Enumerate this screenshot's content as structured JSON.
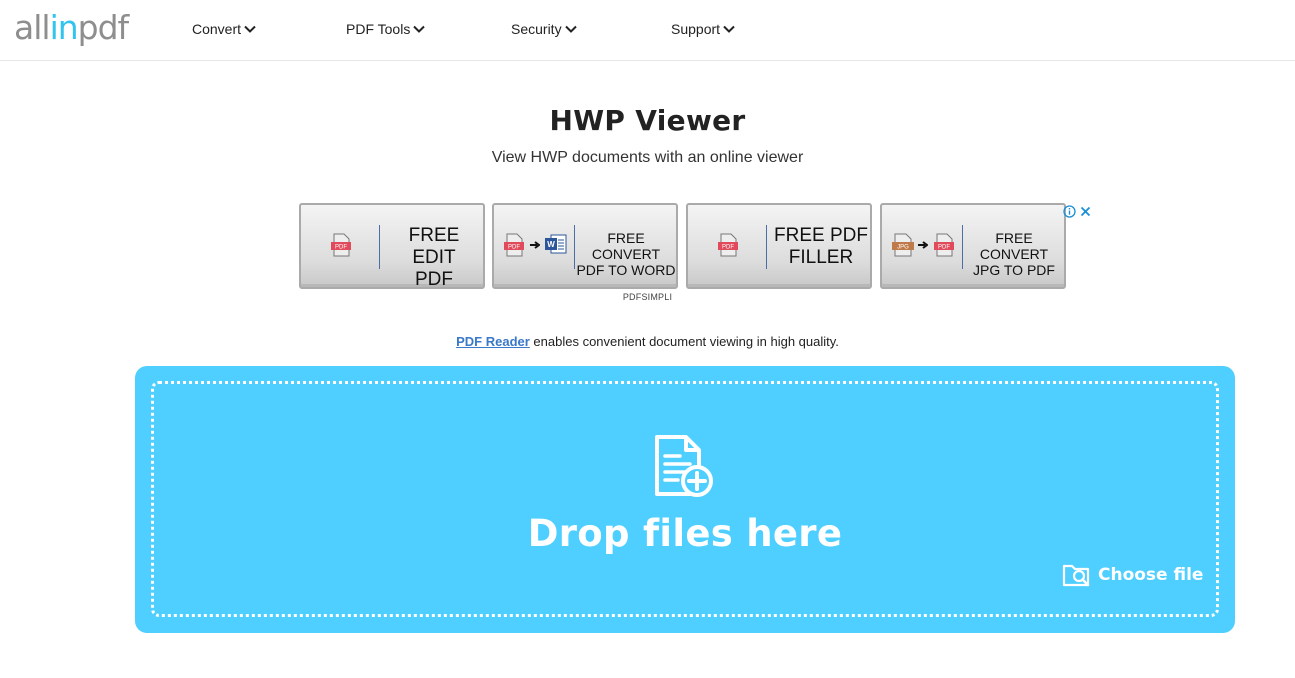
{
  "logo": {
    "part1": "all",
    "part2": "in",
    "part3": "pdf"
  },
  "nav": [
    {
      "label": "Convert"
    },
    {
      "label": "PDF Tools"
    },
    {
      "label": "Security"
    },
    {
      "label": "Support"
    }
  ],
  "page": {
    "title": "HWP Viewer",
    "subtitle": "View HWP documents with an online viewer"
  },
  "ad": {
    "cards": [
      {
        "line1": "FREE EDIT",
        "line2": "PDF"
      },
      {
        "line1": "FREE CONVERT",
        "line2": "PDF TO WORD"
      },
      {
        "line1": "FREE PDF",
        "line2": "FILLER"
      },
      {
        "line1": "FREE CONVERT",
        "line2": "JPG TO PDF"
      }
    ],
    "icon_labels": {
      "pdf": "PDF",
      "jpg": "JPG"
    },
    "sponsor": "PDFSIMPLI"
  },
  "reader": {
    "link_text": "PDF Reader",
    "rest_text": " enables convenient document viewing in high quality."
  },
  "dropzone": {
    "title": "Drop files here",
    "choose_label": "Choose file"
  },
  "colors": {
    "accent": "#33c4ee",
    "dropzone_bg": "#4fcfff",
    "link": "#3a78c9"
  }
}
